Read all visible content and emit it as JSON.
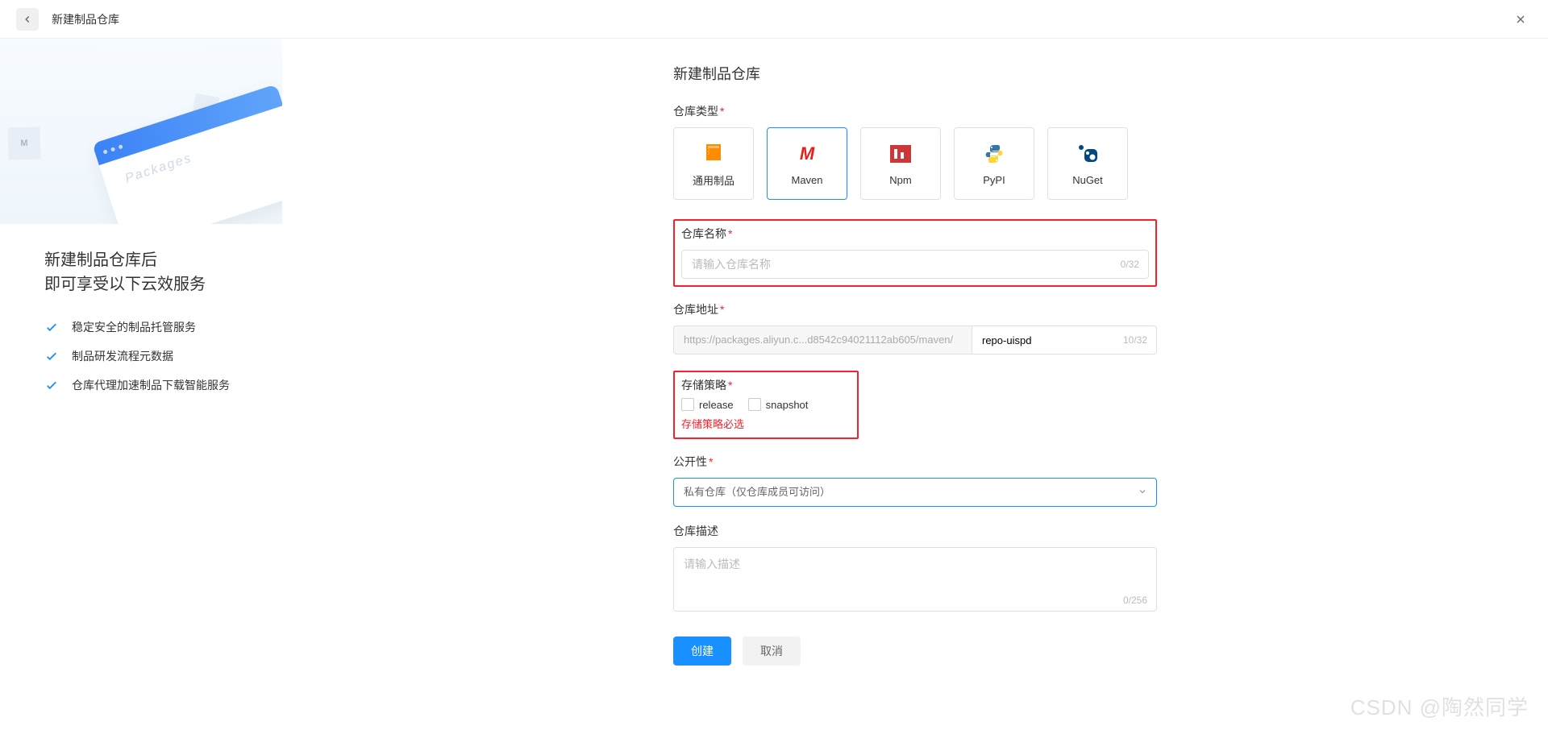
{
  "header": {
    "title": "新建制品仓库"
  },
  "sidebar": {
    "illustration_text": "Packages",
    "heading_line1": "新建制品仓库后",
    "heading_line2": "即可享受以下云效服务",
    "benefits": [
      "稳定安全的制品托管服务",
      "制品研发流程元数据",
      "仓库代理加速制品下载智能服务"
    ]
  },
  "form": {
    "title": "新建制品仓库",
    "type_label": "仓库类型",
    "types": [
      {
        "key": "generic",
        "label": "通用制品"
      },
      {
        "key": "maven",
        "label": "Maven"
      },
      {
        "key": "npm",
        "label": "Npm"
      },
      {
        "key": "pypi",
        "label": "PyPI"
      },
      {
        "key": "nuget",
        "label": "NuGet"
      }
    ],
    "selected_type": "maven",
    "name_label": "仓库名称",
    "name_placeholder": "请输入仓库名称",
    "name_counter": "0/32",
    "addr_label": "仓库地址",
    "addr_prefix": "https://packages.aliyun.c...d8542c94021112ab605/maven/",
    "addr_value": "repo-uispd",
    "addr_counter": "10/32",
    "storage_label": "存储策略",
    "storage_options": {
      "release": "release",
      "snapshot": "snapshot"
    },
    "storage_error": "存储策略必选",
    "visibility_label": "公开性",
    "visibility_value": "私有仓库（仅仓库成员可访问）",
    "desc_label": "仓库描述",
    "desc_placeholder": "请输入描述",
    "desc_counter": "0/256",
    "submit": "创建",
    "cancel": "取消"
  },
  "watermark": "CSDN @陶然同学"
}
